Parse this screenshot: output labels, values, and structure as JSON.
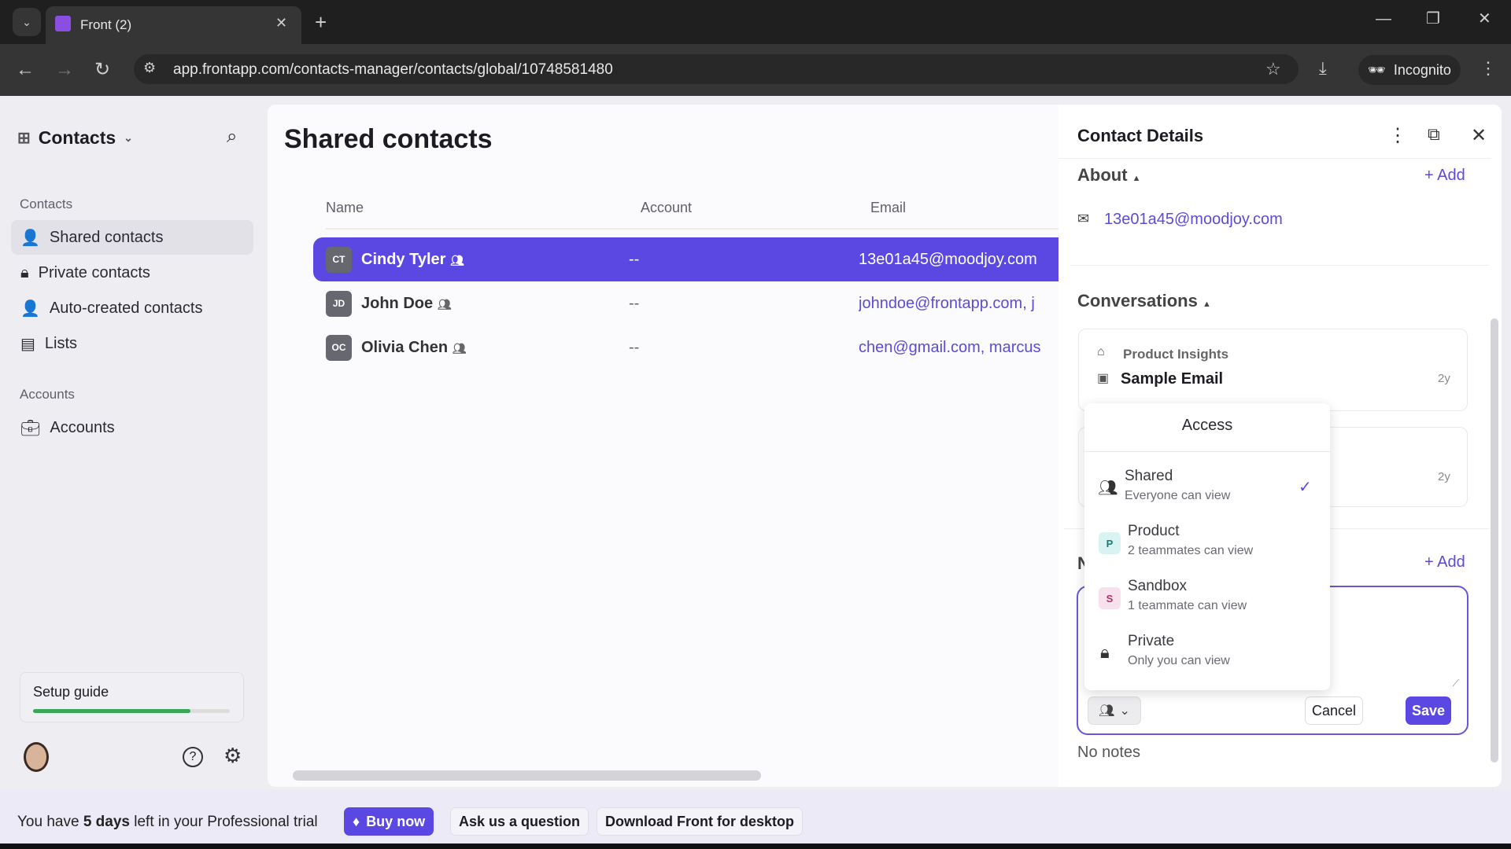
{
  "browser": {
    "tab_title": "Front (2)",
    "url": "app.frontapp.com/contacts-manager/contacts/global/10748581480",
    "incognito_label": "Incognito"
  },
  "sidebar": {
    "header": "Contacts",
    "contacts_section": "Contacts",
    "items": [
      {
        "label": "Shared contacts"
      },
      {
        "label": "Private contacts"
      },
      {
        "label": "Auto-created contacts"
      },
      {
        "label": "Lists"
      }
    ],
    "accounts_section": "Accounts",
    "accounts_item": "Accounts",
    "setup_guide": "Setup guide",
    "setup_progress": 0.8
  },
  "main": {
    "title": "Shared contacts",
    "columns": [
      "Name",
      "Account",
      "Email"
    ],
    "rows": [
      {
        "initials": "CT",
        "name": "Cindy Tyler",
        "account": "--",
        "email": "13e01a45@moodjoy.com"
      },
      {
        "initials": "JD",
        "name": "John Doe",
        "account": "--",
        "email": "johndoe@frontapp.com, j"
      },
      {
        "initials": "OC",
        "name": "Olivia Chen",
        "account": "--",
        "email": "chen@gmail.com, marcus"
      }
    ]
  },
  "details": {
    "title": "Contact Details",
    "about": "About",
    "add": "+ Add",
    "email": "13e01a45@moodjoy.com",
    "conversations": "Conversations",
    "conv1": {
      "inbox": "Product Insights",
      "subject": "Sample Email",
      "age": "2y"
    },
    "conv2": {
      "age": "2y"
    },
    "notes_initial": "N",
    "notes_add": "+ Add",
    "cancel": "Cancel",
    "save": "Save",
    "no_notes": "No notes"
  },
  "access": {
    "title": "Access",
    "options": [
      {
        "title": "Shared",
        "sub": "Everyone can view",
        "badge": ""
      },
      {
        "title": "Product",
        "sub": "2 teammates can view",
        "badge": "P"
      },
      {
        "title": "Sandbox",
        "sub": "1 teammate can view",
        "badge": "S"
      },
      {
        "title": "Private",
        "sub": "Only you can view",
        "badge": ""
      }
    ],
    "selected": "Shared"
  },
  "trial": {
    "pre": "You have ",
    "bold": "5 days",
    "post": " left in your Professional trial",
    "buy": "Buy now",
    "ask": "Ask us a question",
    "download": "Download Front for desktop"
  },
  "colors": {
    "accent": "#5b48e3"
  }
}
